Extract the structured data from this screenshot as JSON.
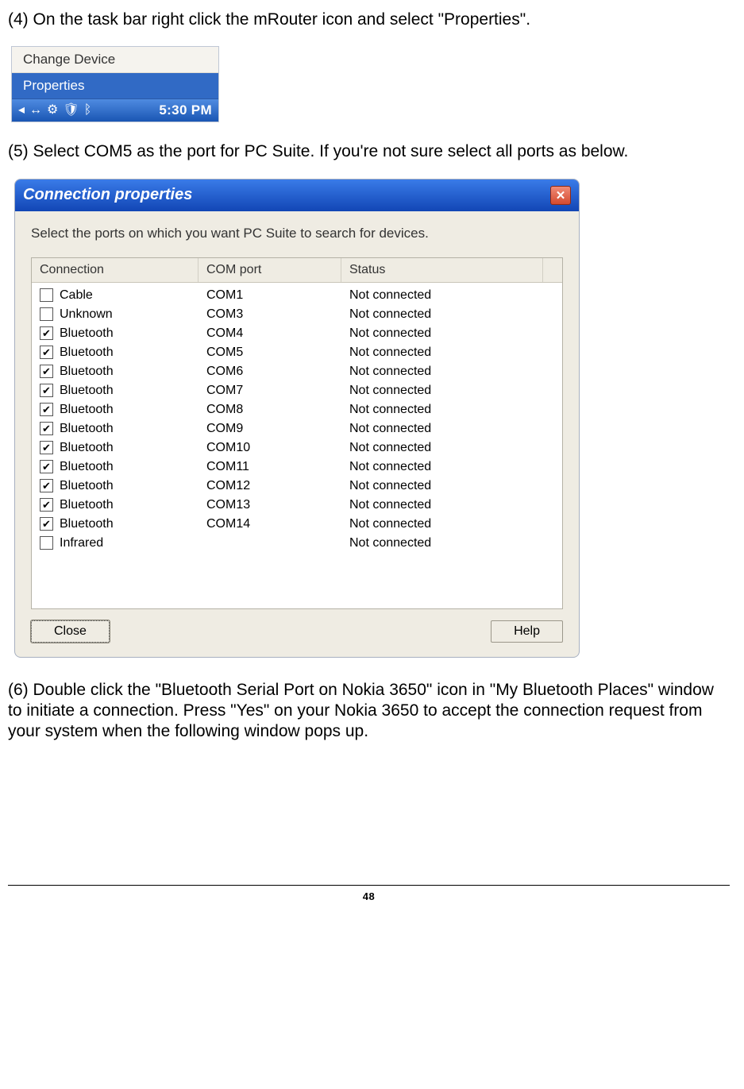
{
  "step4_text": "(4) On the task bar right click the mRouter icon and select \"Properties\".",
  "menu": {
    "item0": "Change Device",
    "item1": "Properties"
  },
  "tray": {
    "clock": "5:30 PM"
  },
  "step5_text": "(5) Select COM5 as the port for PC Suite. If you're not sure select all ports as below.",
  "dialog": {
    "title": "Connection properties",
    "instruction": "Select the ports on which you want PC Suite to search for devices.",
    "headers": {
      "c1": "Connection",
      "c2": "COM port",
      "c3": "Status"
    },
    "rows": [
      {
        "checked": false,
        "conn": "Cable",
        "port": "COM1",
        "status": "Not connected"
      },
      {
        "checked": false,
        "conn": "Unknown",
        "port": "COM3",
        "status": "Not connected"
      },
      {
        "checked": true,
        "conn": "Bluetooth",
        "port": "COM4",
        "status": "Not connected"
      },
      {
        "checked": true,
        "conn": "Bluetooth",
        "port": "COM5",
        "status": "Not connected"
      },
      {
        "checked": true,
        "conn": "Bluetooth",
        "port": "COM6",
        "status": "Not connected"
      },
      {
        "checked": true,
        "conn": "Bluetooth",
        "port": "COM7",
        "status": "Not connected"
      },
      {
        "checked": true,
        "conn": "Bluetooth",
        "port": "COM8",
        "status": "Not connected"
      },
      {
        "checked": true,
        "conn": "Bluetooth",
        "port": "COM9",
        "status": "Not connected"
      },
      {
        "checked": true,
        "conn": "Bluetooth",
        "port": "COM10",
        "status": "Not connected"
      },
      {
        "checked": true,
        "conn": "Bluetooth",
        "port": "COM11",
        "status": "Not connected"
      },
      {
        "checked": true,
        "conn": "Bluetooth",
        "port": "COM12",
        "status": "Not connected"
      },
      {
        "checked": true,
        "conn": "Bluetooth",
        "port": "COM13",
        "status": "Not connected"
      },
      {
        "checked": true,
        "conn": "Bluetooth",
        "port": "COM14",
        "status": "Not connected"
      },
      {
        "checked": false,
        "conn": "Infrared",
        "port": "",
        "status": "Not connected"
      }
    ],
    "close_label": "Close",
    "help_label": "Help"
  },
  "step6_text": "(6) Double click the \"Bluetooth Serial Port on Nokia 3650\" icon in \"My Bluetooth Places\" window to initiate a connection. Press \"Yes\" on your Nokia 3650 to accept the connection request from your system when the following window pops up.",
  "page_number": "48"
}
